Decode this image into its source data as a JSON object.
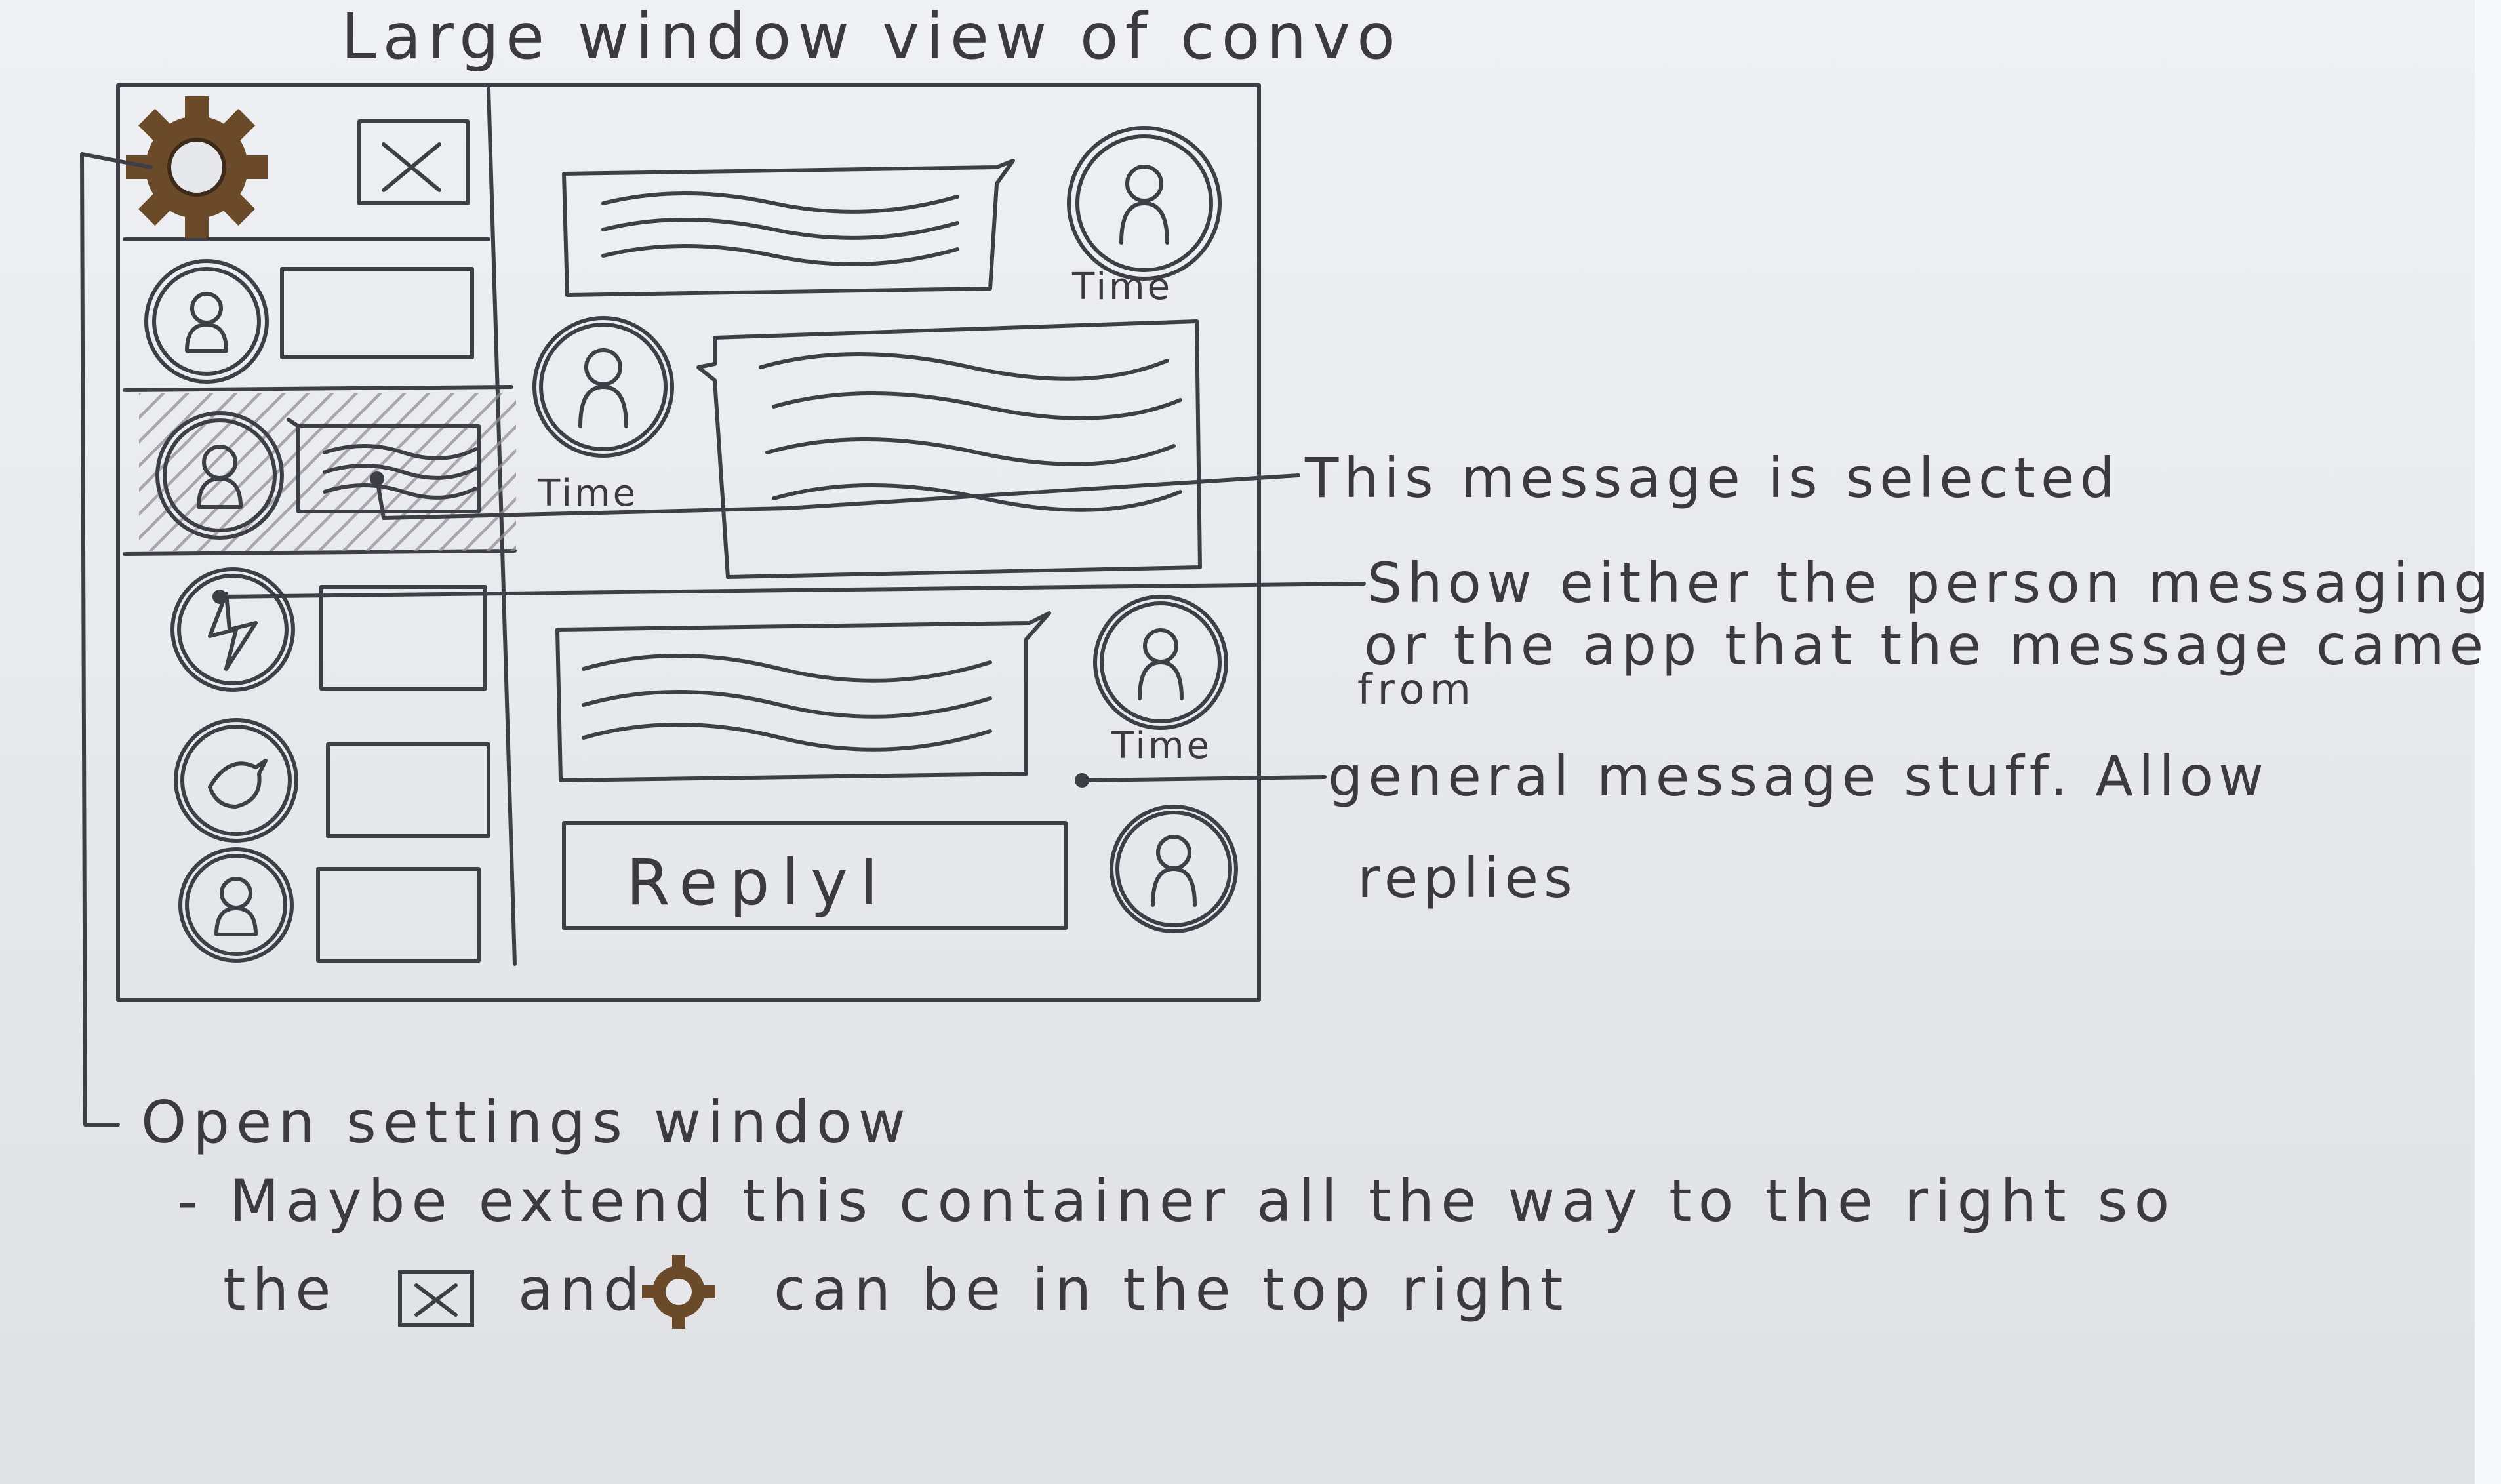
{
  "title": "Large window view of convo",
  "time_label": "Time",
  "reply_label": "ReplyI",
  "annotations": {
    "selected": "This message is selected",
    "show_line1": "Show either the person messaging",
    "show_line2": "or the app that the message came",
    "show_line3": "from",
    "general_line1": "general message stuff. Allow",
    "general_line2": "replies"
  },
  "notes": {
    "settings": "Open settings window",
    "extend": "- Maybe extend this container all the way to the right so",
    "the": "the",
    "and": "and",
    "corner": "can be in the top right"
  },
  "icons": [
    "gear-icon",
    "close-icon",
    "person-icon",
    "lightning-icon",
    "bird-icon"
  ]
}
